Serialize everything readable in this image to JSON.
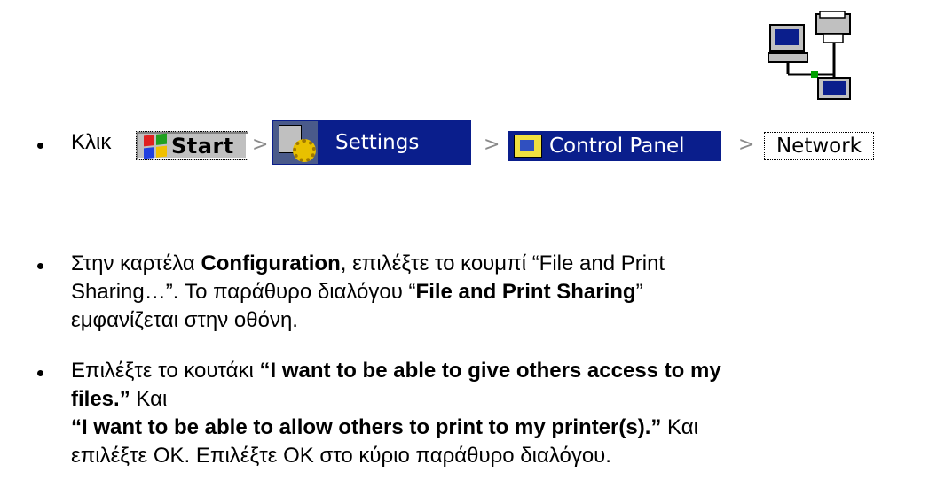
{
  "step1": {
    "prefix": "Κλικ",
    "start_label": "Start",
    "settings_label": "Settings",
    "control_panel_label": "Control Panel",
    "network_label": "Network",
    "separator": ">"
  },
  "step2": {
    "t1": "Στην καρτέλα ",
    "t2_bold": "Configuration",
    "t3": ", επιλέξτε  το κουμπί “File and Print",
    "t4": "Sharing…”. Το παράθυρο διαλόγου “",
    "t5_bold": "File and Print Sharing",
    "t6": "”",
    "t7": "εμφανίζεται στην οθόνη."
  },
  "step3": {
    "t1": "Επιλέξτε το κουτάκι  ",
    "t2_bold": "“I want to be able to give others access to my",
    "t3_bold": "files.”",
    "t4": " Και",
    "t5_bold": "“I want to be able to allow others to print to my printer(s).”",
    "t6": " Και",
    "t7": "επιλέξτε OK. Επιλέξτε OK στο κύριο παράθυρο διαλόγου."
  },
  "icons": {
    "start": "windows-flag-icon",
    "settings": "settings-gear-icon",
    "control_panel": "control-panel-folder-icon",
    "network": "network-computers-icon"
  }
}
